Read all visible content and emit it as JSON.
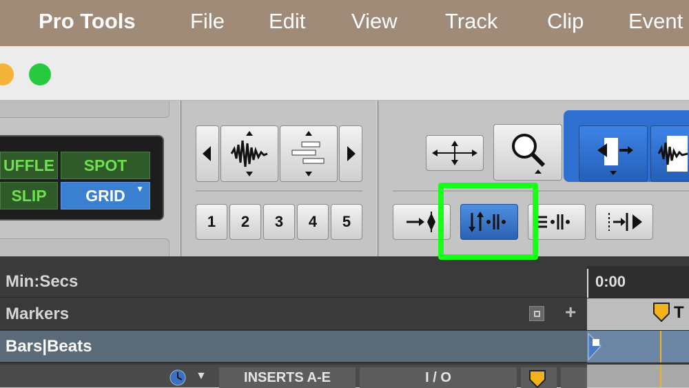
{
  "menubar": {
    "items": [
      "Pro Tools",
      "File",
      "Edit",
      "View",
      "Track",
      "Clip",
      "Event"
    ]
  },
  "edit_modes": {
    "shuffle": "UFFLE",
    "spot": "SPOT",
    "slip": "SLIP",
    "grid": "GRID",
    "active": "GRID"
  },
  "zoom_presets": [
    "1",
    "2",
    "3",
    "4",
    "5"
  ],
  "rulers": {
    "min_secs": "Min:Secs",
    "markers": "Markers",
    "bars_beats": "Bars|Beats",
    "time_start": "0:00",
    "marker_text": "T"
  },
  "track_header": {
    "inserts": "INSERTS A-E",
    "io": "I / O"
  },
  "highlighted_tool": "link-timeline-edit-selection-button",
  "colors": {
    "highlight": "#19ff19",
    "active_blue": "#3b7fd0",
    "mode_green": "#6fe04f",
    "marker_yellow": "#f2b21a"
  }
}
